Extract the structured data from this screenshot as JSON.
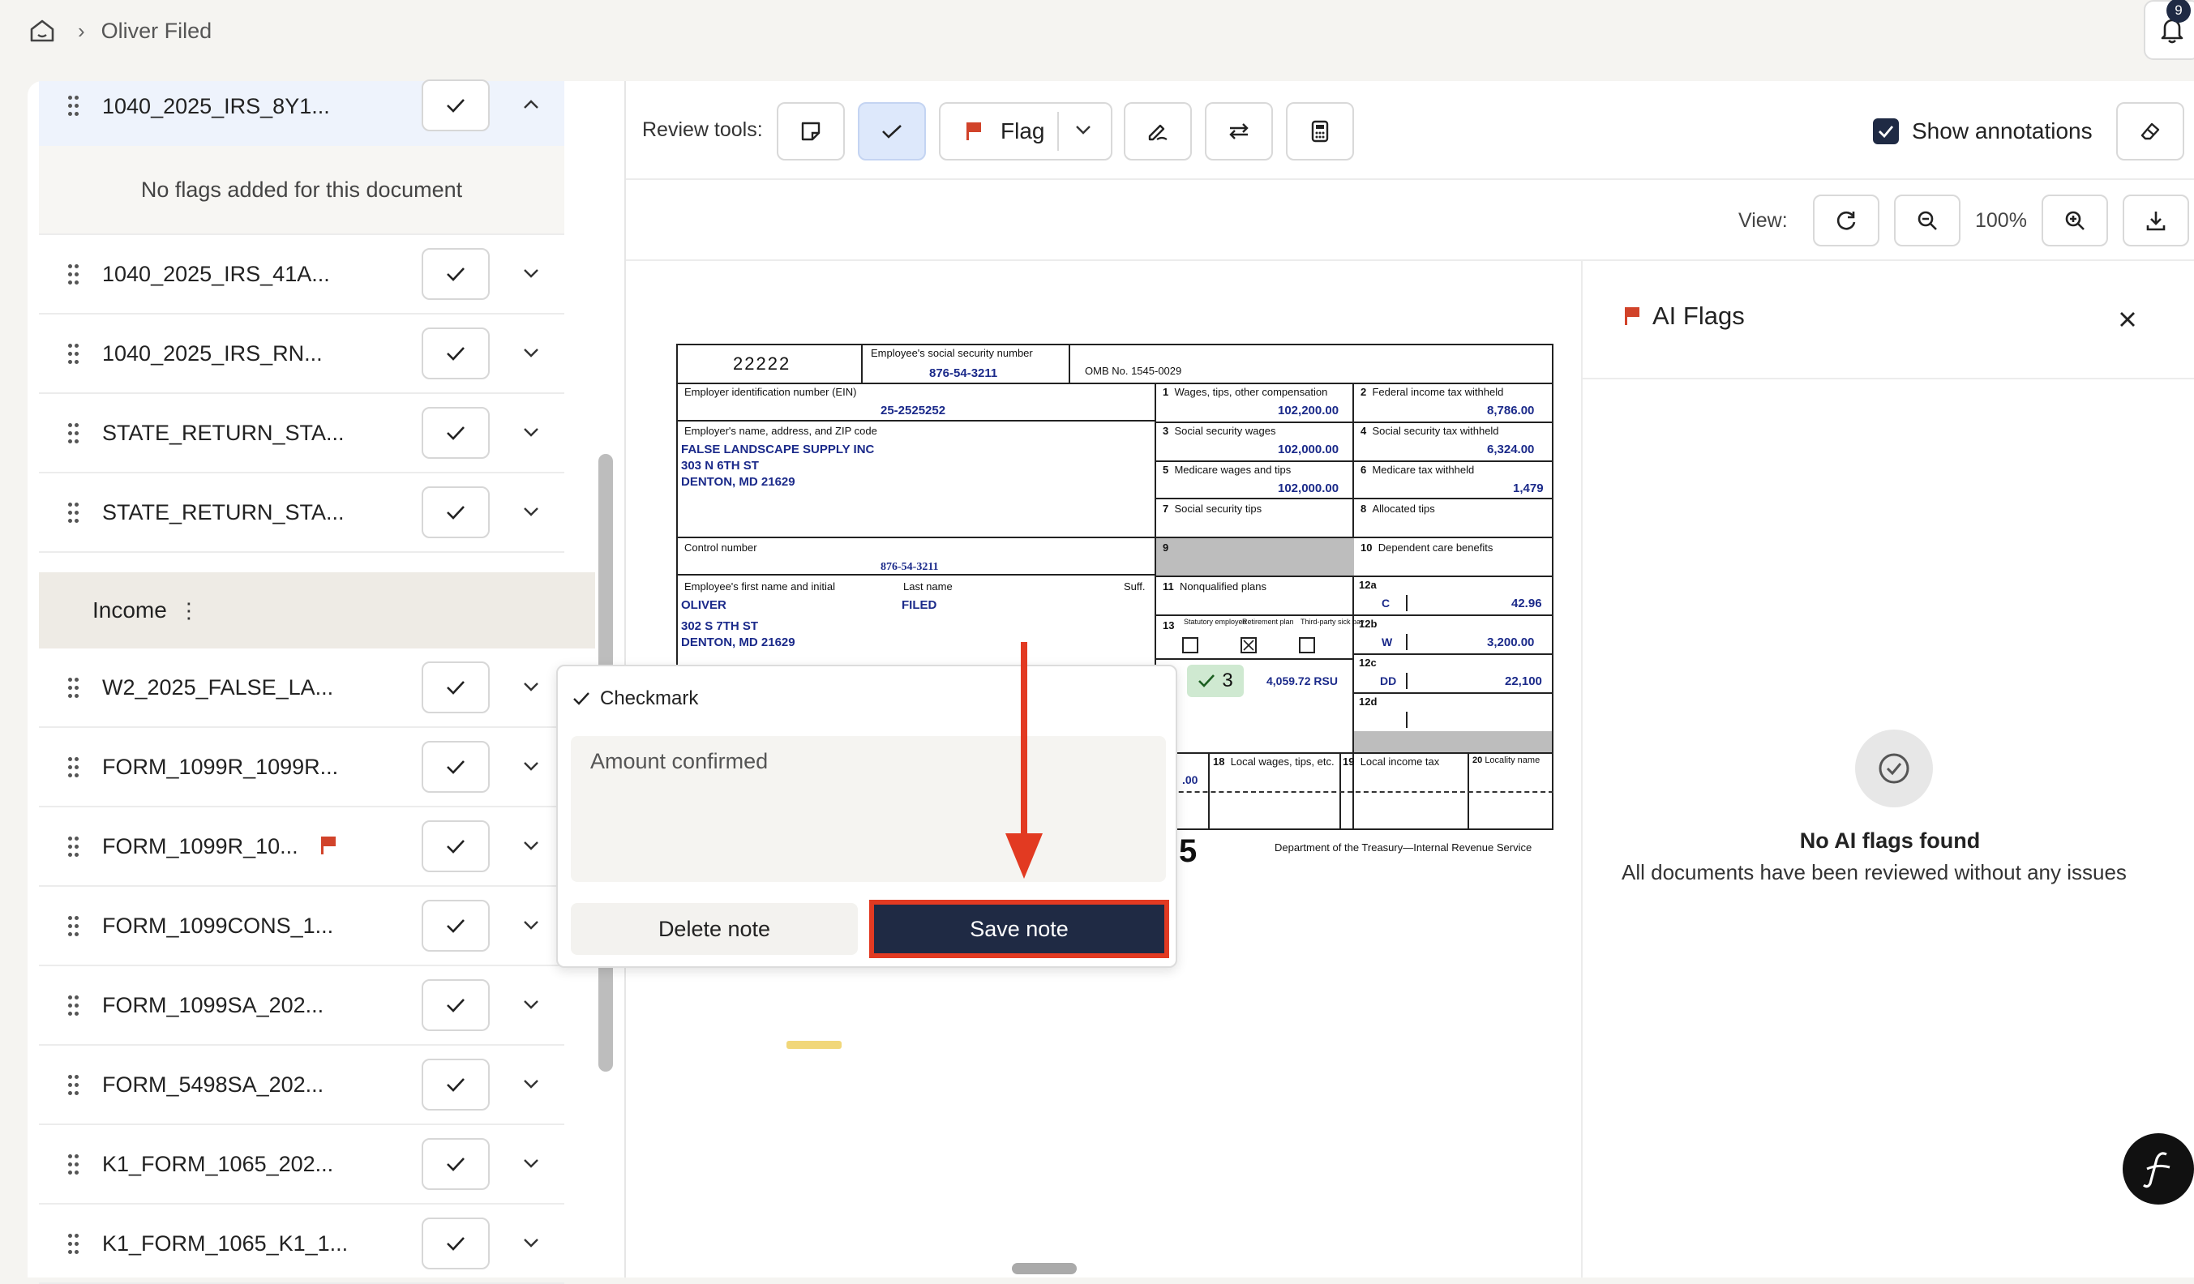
{
  "breadcrumb": {
    "current": "Oliver Filed"
  },
  "notifications": {
    "count": "9"
  },
  "sidebar": {
    "expanded_doc": {
      "name": "1040_2025_IRS_8Y1...",
      "empty_text": "No flags added for this document"
    },
    "docs_top": [
      {
        "name": "1040_2025_IRS_41A..."
      },
      {
        "name": "1040_2025_IRS_RN..."
      },
      {
        "name": "STATE_RETURN_STA..."
      },
      {
        "name": "STATE_RETURN_STA..."
      }
    ],
    "section": {
      "label": "Income",
      "menu": "⋮"
    },
    "docs_income": [
      {
        "name": "W2_2025_FALSE_LA...",
        "flagged": false
      },
      {
        "name": "FORM_1099R_1099R...",
        "flagged": false
      },
      {
        "name": "FORM_1099R_10...",
        "flagged": true
      },
      {
        "name": "FORM_1099CONS_1...",
        "flagged": false
      },
      {
        "name": "FORM_1099SA_202...",
        "flagged": false
      },
      {
        "name": "FORM_5498SA_202...",
        "flagged": false
      },
      {
        "name": "K1_FORM_1065_202...",
        "flagged": false
      },
      {
        "name": "K1_FORM_1065_K1_1...",
        "flagged": false
      }
    ]
  },
  "toolbar": {
    "label": "Review tools:",
    "flag_label": "Flag",
    "show_annotations_label": "Show annotations",
    "show_annotations_checked": true
  },
  "view": {
    "label": "View:",
    "zoom": "100%"
  },
  "w2": {
    "box_code": "22222",
    "a_label": "Employee's social security number",
    "a_value": "876-54-3211",
    "omb": "OMB No. 1545-0029",
    "b_label": "Employer identification number (EIN)",
    "b_value": "25-2525252",
    "c_label": "Employer's name, address, and ZIP code",
    "employer_name": "FALSE LANDSCAPE SUPPLY INC",
    "employer_addr1": "303 N 6TH ST",
    "employer_addr2": "DENTON, MD 21629",
    "d_label": "Control number",
    "d_value": "876-54-3211",
    "e_label": "Employee's first name and initial",
    "last_label": "Last name",
    "suff_label": "Suff.",
    "first_name": "OLIVER",
    "last_name": "FILED",
    "emp_addr1": "302 S 7TH ST",
    "emp_addr2": "DENTON, MD 21629",
    "box1_label": "Wages, tips, other compensation",
    "box1_value": "102,200.00",
    "box2_label": "Federal income tax withheld",
    "box2_value": "8,786.00",
    "box3_label": "Social security wages",
    "box3_value": "102,000.00",
    "box4_label": "Social security tax withheld",
    "box4_value": "6,324.00",
    "box5_label": "Medicare wages and tips",
    "box5_value": "102,000.00",
    "box6_label": "Medicare tax withheld",
    "box6_value": "1,479",
    "box7_label": "Social security tips",
    "box8_label": "Allocated tips",
    "box9_label": "9",
    "box10_label": "Dependent care benefits",
    "box11_label": "Nonqualified plans",
    "box13_statutory": "Statutory employee",
    "box13_retirement": "Retirement plan",
    "box13_thirdparty": "Third-party sick pay",
    "box12a_code": "C",
    "box12a_value": "42.96",
    "box12b_code": "W",
    "box12b_value": "3,200.00",
    "box12c_code": "DD",
    "box12c_value": "22,100",
    "box14_value": "4,059.72 RSU",
    "annotation_count": "3",
    "box18_label": "Local wages, tips, etc.",
    "box19_label": "Local income tax",
    "box20_label": "Locality name",
    "partial_value": ".00",
    "year_tail": "5",
    "dept": "Department of the Treasury—Internal Revenue Service"
  },
  "note_popup": {
    "type_label": "Checkmark",
    "text": "Amount confirmed",
    "delete_label": "Delete note",
    "save_label": "Save note"
  },
  "ai_flags": {
    "title": "AI Flags",
    "empty_title": "No AI flags found",
    "empty_sub": "All documents have been reviewed without any issues"
  },
  "colors": {
    "navy": "#1f2a44",
    "flag_red": "#d1432a",
    "highlight": "#e23a22"
  }
}
